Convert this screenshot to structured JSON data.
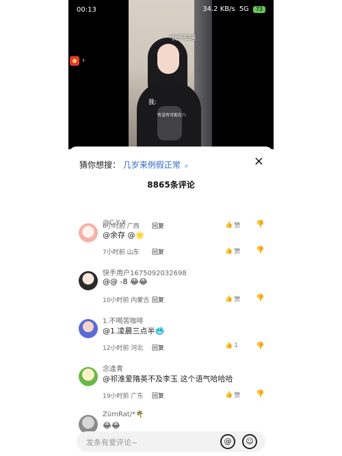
{
  "status": {
    "time": "00:13",
    "net": "34.2",
    "net_unit": "KB/s",
    "badge": "5G",
    "battery": "73"
  },
  "video": {
    "overlay_top": "*我不知道",
    "overlay_mid": "我:",
    "overlay_small": "有没有可能在八"
  },
  "sheet": {
    "suggest_prefix": "猜你想搜：",
    "suggest_query": "几岁来例假正常",
    "suggest_icon": "search-icon",
    "close_symbol": "×",
    "count_label": "8865条评论"
  },
  "comments": [
    {
      "user": "",
      "text": "",
      "meta": "6小时前 广西",
      "reply": "回复",
      "like": "赞",
      "dislike": "↓"
    },
    {
      "user": "@C-Y-X",
      "text": "@余存 @🌟",
      "meta": "7小时前 山东",
      "reply": "回复",
      "like": "赞",
      "dislike": "↓"
    },
    {
      "user": "快手用户1675092032698",
      "text": "@@ -8 😂😂",
      "meta": "10小时前 内蒙古",
      "reply": "回复",
      "like": "赞",
      "dislike": "↓"
    },
    {
      "user": "1.不喝苦咖啡",
      "text": "@1.凌晨三点半🥶",
      "meta": "12小时前 河北",
      "reply": "回复",
      "like": "1",
      "dislike": "↓"
    },
    {
      "user": "念逢青",
      "text": "@祁淮爱隋英不及李玉 这个语气哈哈哈",
      "meta": "19小时前 广东",
      "reply": "回复",
      "like": "赞",
      "dislike": "↓"
    },
    {
      "user": "ZümRat/*🌴",
      "text": "😂😂",
      "meta": "",
      "reply": "",
      "like": "",
      "dislike": ""
    }
  ],
  "input": {
    "placeholder": "发条有爱评论~",
    "at_icon": "@",
    "emoji_icon": "☺"
  },
  "colors": {
    "accent_blue": "#2e63c7",
    "video_bg": "#000000"
  }
}
